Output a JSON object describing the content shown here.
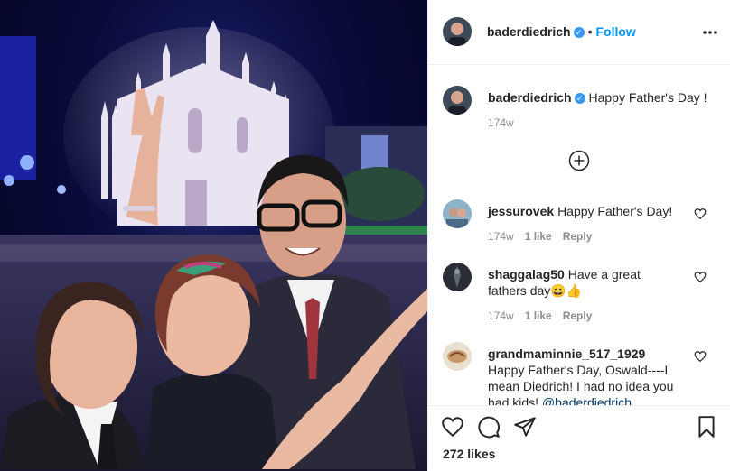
{
  "post": {
    "author": "baderdiedrich",
    "follow_label": "Follow",
    "separator": "•",
    "caption": "Happy Father's Day !",
    "caption_age": "174w",
    "likes": "272 likes"
  },
  "comments": [
    {
      "user": "jessurovek",
      "text": "Happy Father's Day!",
      "age": "174w",
      "likes": "1 like",
      "reply": "Reply"
    },
    {
      "user": "shaggalag50",
      "text": "Have a great fathers day😄👍",
      "age": "174w",
      "likes": "1 like",
      "reply": "Reply"
    },
    {
      "user": "grandmaminnie_517_1929",
      "text": "Happy Father's Day, Oswald----I mean Diedrich! I had no idea you had kids! ",
      "mention": "@baderdiedrich"
    }
  ],
  "icons": {
    "more": "more-options-icon",
    "verified": "verified-badge-icon",
    "load_more": "plus-circle-icon",
    "like": "heart-icon",
    "comment": "comment-icon",
    "share": "paper-plane-icon",
    "save": "bookmark-icon"
  },
  "colors": {
    "link_blue": "#0095f6",
    "verified_blue": "#3897f0",
    "meta_gray": "#8e8e8e",
    "text": "#262626"
  }
}
